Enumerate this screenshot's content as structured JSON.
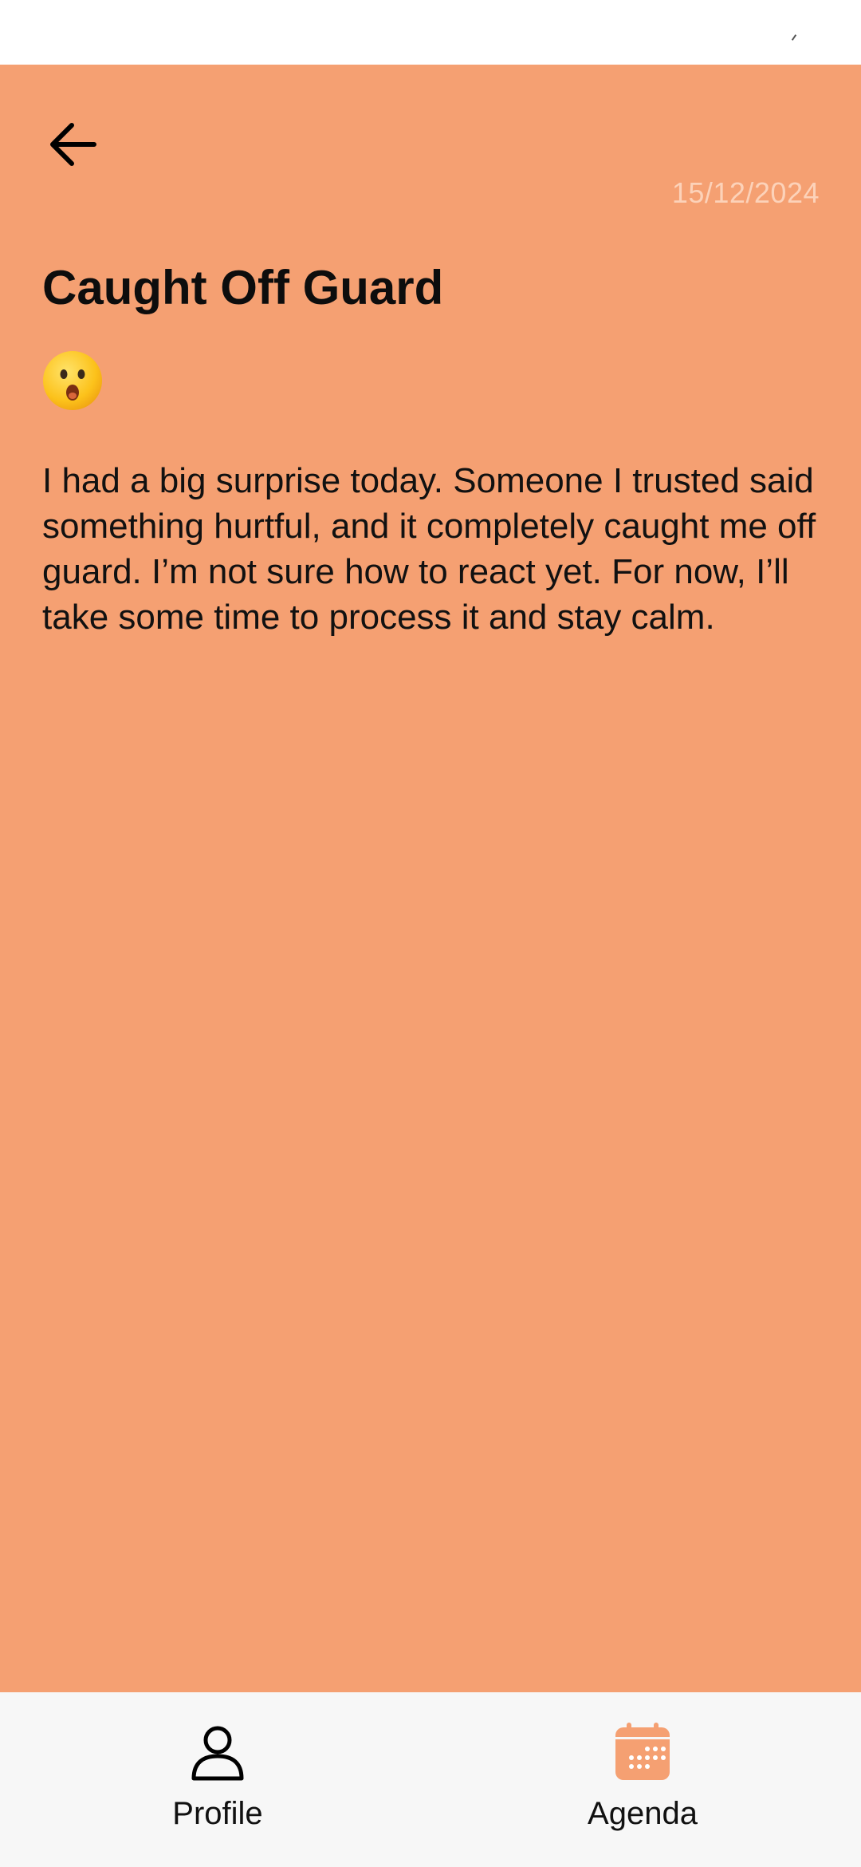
{
  "entry": {
    "date": "15/12/2024",
    "title": "Caught Off Guard",
    "mood_icon": "astonished-face-icon",
    "body": "I had a big surprise today. Someone I trusted said something hurtful, and it completely caught me off guard. I’m not sure how to react yet. For now, I’ll take some time to process it and stay calm."
  },
  "nav": {
    "profile_label": "Profile",
    "profile_icon": "person-icon",
    "agenda_label": "Agenda",
    "agenda_icon": "calendar-icon"
  },
  "colors": {
    "background": "#f5a072",
    "date_text": "#fcd2b9",
    "nav_background": "#f7f7f7",
    "agenda_accent": "#f5a072"
  }
}
